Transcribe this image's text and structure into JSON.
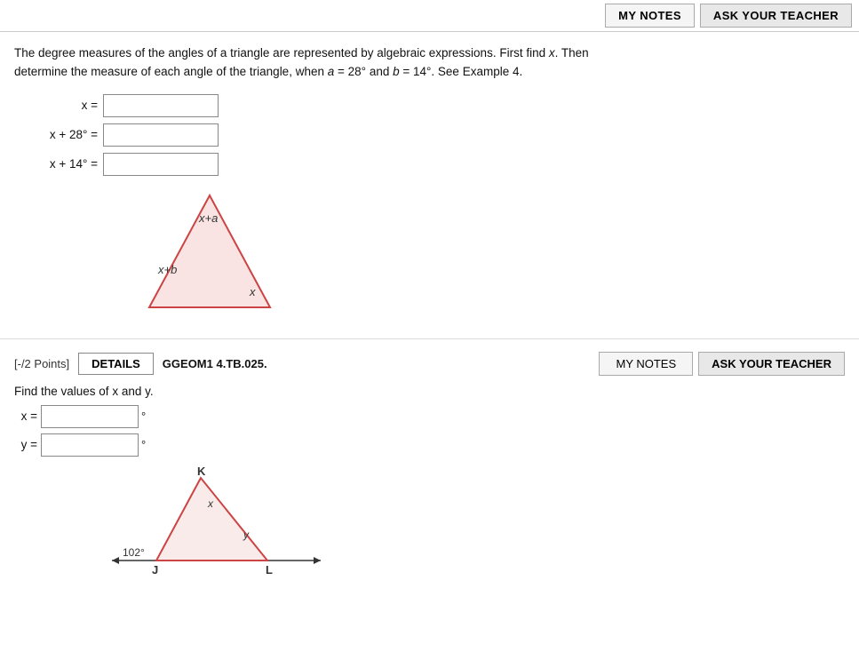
{
  "topbar": {
    "my_notes_label": "MY NOTES",
    "ask_teacher_label": "ASK YOUR TEACHER"
  },
  "section1": {
    "problem_text_1": "The degree measures of the angles of a triangle are represented by algebraic expressions. First find ",
    "problem_text_x": "x",
    "problem_text_2": ". Then",
    "problem_text_3": "determine the measure of each angle of the triangle, when ",
    "problem_text_a": "a",
    "problem_text_eq1": " = 28°",
    "problem_text_and": " and ",
    "problem_text_b": "b",
    "problem_text_eq2": " = 14°",
    "problem_text_4": ". See Example 4.",
    "row1_label": "x =",
    "row2_label": "x + 28° =",
    "row3_label": "x + 14° =",
    "input1_placeholder": "",
    "input2_placeholder": "",
    "input3_placeholder": ""
  },
  "section2": {
    "points_label": "[-/2 Points]",
    "details_label": "DETAILS",
    "problem_id": "GGEOM1 4.TB.025.",
    "my_notes_label": "MY NOTES",
    "ask_teacher_label": "ASK YOUR TEACHER",
    "find_text": "Find the values of x and y.",
    "x_label": "x =",
    "y_label": "y =",
    "degree1": "°",
    "degree2": "°"
  },
  "diagram1": {
    "label_top": "x+a",
    "label_left": "x+b",
    "label_right": "x"
  },
  "diagram2": {
    "label_k": "K",
    "label_x": "x",
    "label_y": "y",
    "label_j": "J",
    "label_l": "L",
    "angle_102": "102°"
  },
  "icons": {
    "degree": "°"
  }
}
